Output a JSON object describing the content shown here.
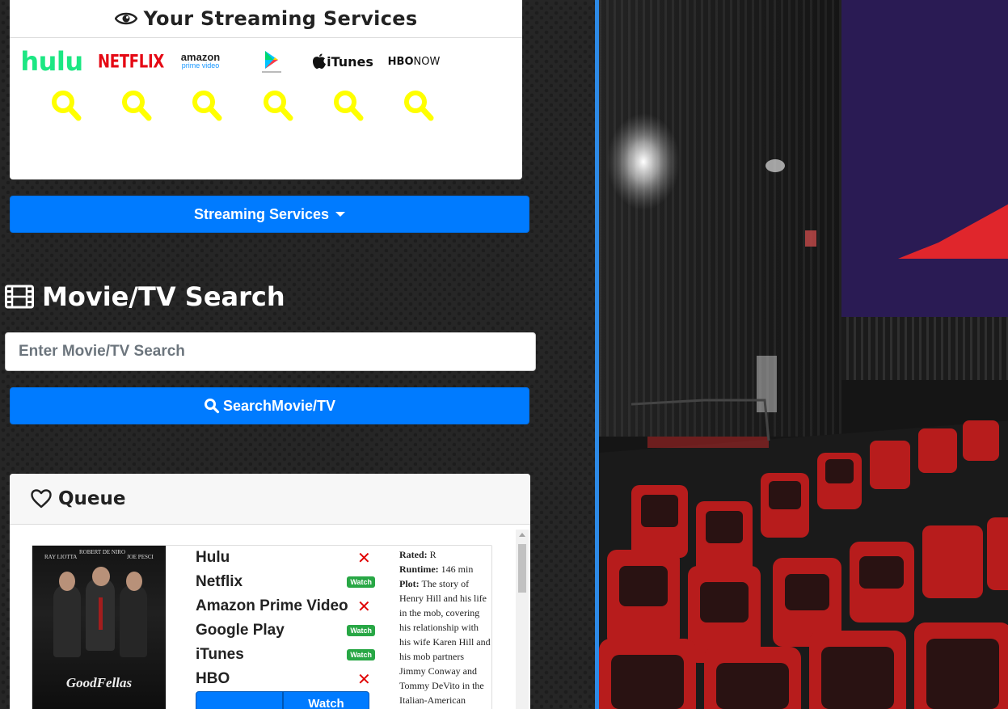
{
  "streaming_card": {
    "title": "Your Streaming Services",
    "services": [
      {
        "name": "hulu",
        "display": "hulu",
        "color": "#1ce783"
      },
      {
        "name": "netflix",
        "display": "NETFLIX",
        "color": "#e50914"
      },
      {
        "name": "amazon",
        "display": "amazon",
        "sub": "prime video"
      },
      {
        "name": "google-play",
        "display": "Google Play"
      },
      {
        "name": "itunes",
        "display": "iTunes"
      },
      {
        "name": "hbo-now",
        "display": "HBO",
        "sub": "NOW"
      }
    ],
    "search_icon_color": "#ffff00"
  },
  "streaming_dropdown": {
    "label": "Streaming Services"
  },
  "search_section": {
    "title": "Movie/TV Search",
    "input_placeholder": "Enter Movie/TV Search",
    "button_label": "SearchMovie/TV"
  },
  "queue": {
    "title": "Queue",
    "items": [
      {
        "poster": {
          "credits": [
            "RAY LIOTTA",
            "ROBERT DE NIRO",
            "JOE PESCI"
          ],
          "title": "GoodFellas"
        },
        "providers": [
          {
            "name": "Hulu",
            "status": "unavailable"
          },
          {
            "name": "Netflix",
            "status": "watch"
          },
          {
            "name": "Amazon Prime Video",
            "status": "unavailable"
          },
          {
            "name": "Google Play",
            "status": "watch"
          },
          {
            "name": "iTunes",
            "status": "watch"
          },
          {
            "name": "HBO",
            "status": "unavailable"
          }
        ],
        "watch_badge": "Watch",
        "watch_button": "Watch",
        "rated_label": "Rated:",
        "rated": "R",
        "runtime_label": "Runtime:",
        "runtime": "146 min",
        "plot_label": "Plot:",
        "plot": "The story of Henry Hill and his life in the mob, covering his relationship with his wife Karen Hill and his mob partners Jimmy Conway and Tommy DeVito in the Italian-American"
      }
    ]
  },
  "colors": {
    "primary": "#007bff",
    "accent_border": "#2d8ae6",
    "success": "#28a745",
    "danger": "#e00000"
  }
}
